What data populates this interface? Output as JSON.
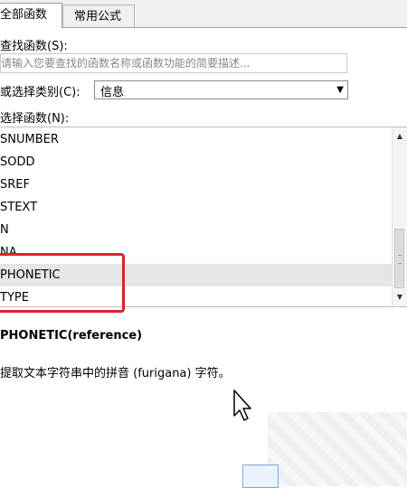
{
  "tabs": [
    {
      "label": "全部函数",
      "active": true
    },
    {
      "label": "常用公式",
      "active": false
    }
  ],
  "search": {
    "label": "查找函数(S):",
    "placeholder": "请输入您要查找的函数名称或函数功能的简要描述..."
  },
  "category": {
    "label": "或选择类别(C):",
    "value": "信息"
  },
  "function_list": {
    "label": "选择函数(N):",
    "items": [
      "SNUMBER",
      "SODD",
      "SREF",
      "STEXT",
      "N",
      "NA",
      "PHONETIC",
      "TYPE"
    ],
    "selected_index": 6
  },
  "syntax": "PHONETIC(reference)",
  "description": "提取文本字符串中的拼音 (furigana) 字符。",
  "colors": {
    "highlight": "#d9242b",
    "selected_row": "#e6e6e6"
  }
}
